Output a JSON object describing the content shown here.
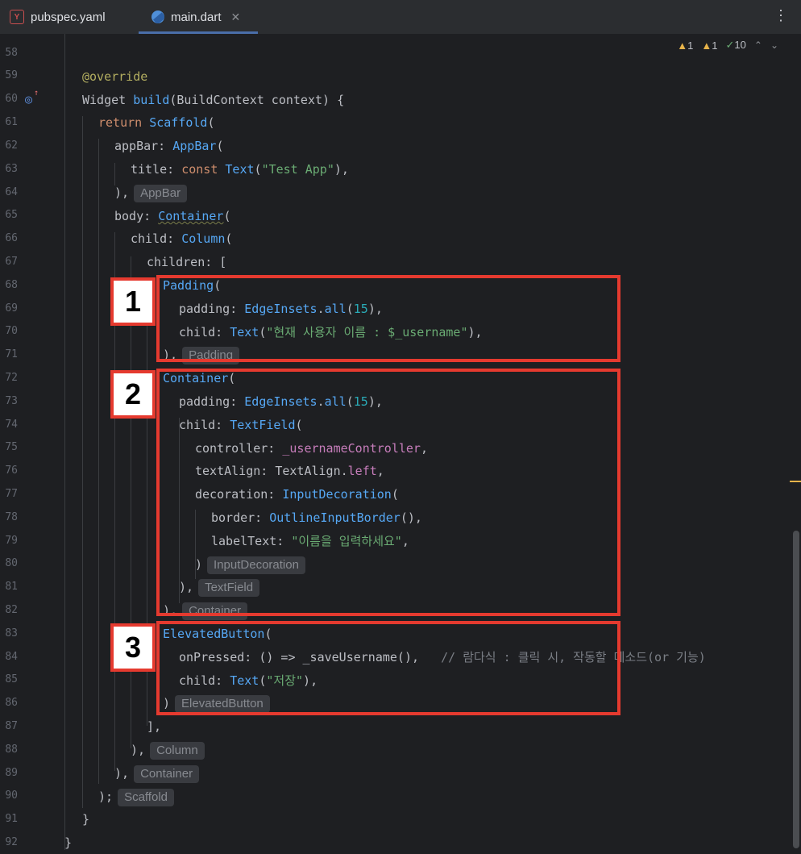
{
  "tabs": [
    {
      "label": "pubspec.yaml",
      "icon": "yaml-file-icon"
    },
    {
      "label": "main.dart",
      "icon": "dart-file-icon",
      "active": true
    }
  ],
  "inspection": {
    "warnings": "1",
    "weak_warnings": "1",
    "typos": "10"
  },
  "lines": {
    "58": "58",
    "59": "59",
    "60": "60",
    "61": "61",
    "62": "62",
    "63": "63",
    "64": "64",
    "65": "65",
    "66": "66",
    "67": "67",
    "68": "68",
    "69": "69",
    "70": "70",
    "71": "71",
    "72": "72",
    "73": "73",
    "74": "74",
    "75": "75",
    "76": "76",
    "77": "77",
    "78": "78",
    "79": "79",
    "80": "80",
    "81": "81",
    "82": "82",
    "83": "83",
    "84": "84",
    "85": "85",
    "86": "86",
    "87": "87",
    "88": "88",
    "89": "89",
    "90": "90",
    "91": "91",
    "92": "92"
  },
  "code": {
    "l59_ann": "@override",
    "l60_type": "Widget ",
    "l60_fn": "build",
    "l60_rest": "(BuildContext context) {",
    "l61_kw": "return ",
    "l61_cls": "Scaffold",
    "l61_rest": "(",
    "l62_a": "appBar: ",
    "l62_cls": "AppBar",
    "l62_b": "(",
    "l63_a": "title: ",
    "l63_kw": "const ",
    "l63_cls": "Text",
    "l63_b": "(",
    "l63_str": "\"Test App\"",
    "l63_c": "),",
    "l64_a": "),",
    "l64_hint": "AppBar",
    "l65_a": "body: ",
    "l65_cls": "Container",
    "l65_b": "(",
    "l66_a": "child: ",
    "l66_cls": "Column",
    "l66_b": "(",
    "l67_a": "children: [",
    "l68_cls": "Padding",
    "l68_b": "(",
    "l69_a": "padding: ",
    "l69_cls": "EdgeInsets",
    "l69_b": ".",
    "l69_fn": "all",
    "l69_c": "(",
    "l69_num": "15",
    "l69_d": "),",
    "l70_a": "child: ",
    "l70_cls": "Text",
    "l70_b": "(",
    "l70_str": "\"현재 사용자 이름 : $_username\"",
    "l70_c": "),",
    "l71_a": "),",
    "l71_hint": "Padding",
    "l72_cls": "Container",
    "l72_b": "(",
    "l73_a": "padding: ",
    "l73_cls": "EdgeInsets",
    "l73_b": ".",
    "l73_fn": "all",
    "l73_c": "(",
    "l73_num": "15",
    "l73_d": "),",
    "l74_a": "child: ",
    "l74_cls": "TextField",
    "l74_b": "(",
    "l75_a": "controller: ",
    "l75_fld": "_usernameController",
    "l75_b": ",",
    "l76_a": "textAlign: TextAlign.",
    "l76_fld": "left",
    "l76_b": ",",
    "l77_a": "decoration: ",
    "l77_cls": "InputDecoration",
    "l77_b": "(",
    "l78_a": "border: ",
    "l78_cls": "OutlineInputBorder",
    "l78_b": "(),",
    "l79_a": "labelText: ",
    "l79_str": "\"이름을 입력하세요\"",
    "l79_b": ",",
    "l80_a": ")",
    "l80_hint": "InputDecoration",
    "l81_a": "),",
    "l81_hint": "TextField",
    "l82_a": "),",
    "l82_hint": "Container",
    "l83_cls": "ElevatedButton",
    "l83_b": "(",
    "l84_a": "onPressed: () => _saveUsername(),",
    "l84_cmt": "// 람다식 : 클릭 시, 작동할 메소드(or 기능)",
    "l85_a": "child: ",
    "l85_cls": "Text",
    "l85_b": "(",
    "l85_str": "\"저장\"",
    "l85_c": "),",
    "l86_a": ")",
    "l86_hint": "ElevatedButton",
    "l87_a": "],",
    "l88_a": "),",
    "l88_hint": "Column",
    "l89_a": "),",
    "l89_hint": "Container",
    "l90_a": ");",
    "l90_hint": "Scaffold",
    "l91_a": "}",
    "l92_a": "}"
  },
  "callouts": [
    "1",
    "2",
    "3"
  ],
  "colors": {
    "highlight": "#e53a2f",
    "background": "#1e1f22"
  }
}
